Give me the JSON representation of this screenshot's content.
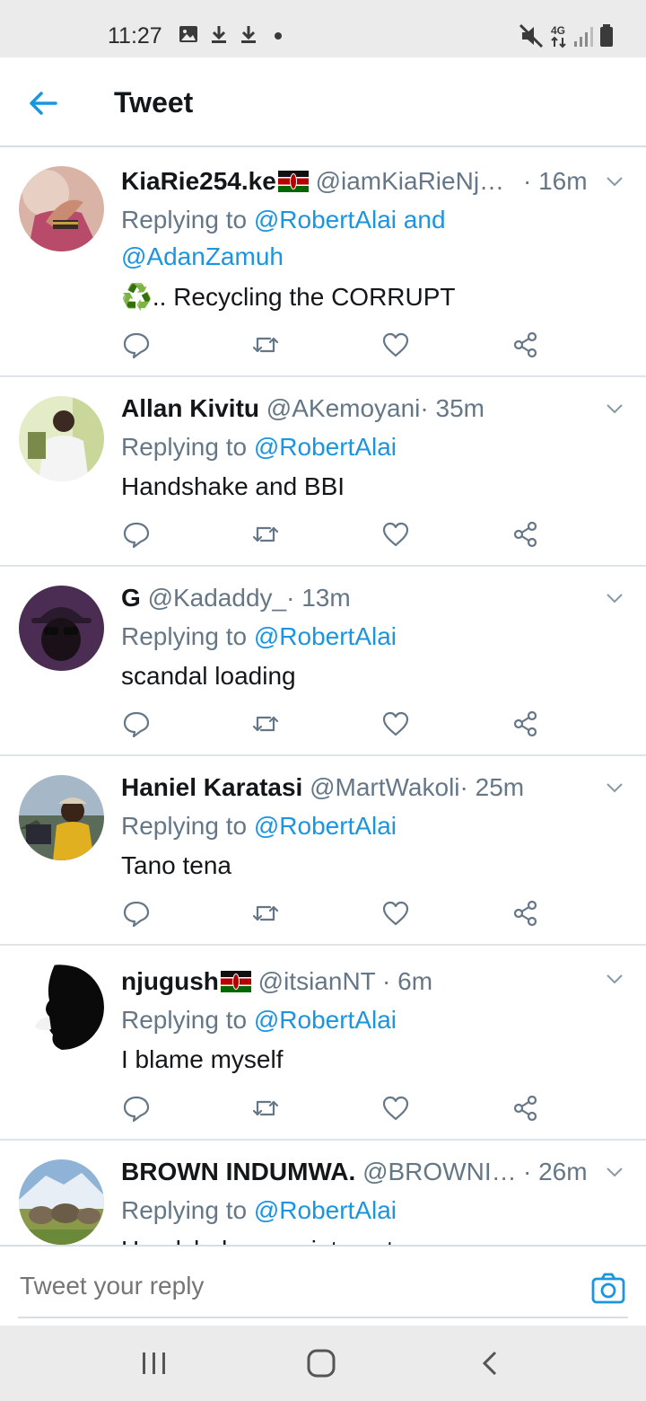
{
  "status_bar": {
    "time": "11:27",
    "left_icons": [
      "image-icon",
      "download-icon",
      "download-icon",
      "dot-icon"
    ],
    "right_icons": [
      "mute-icon",
      "4g-icon",
      "signal-icon",
      "battery-icon"
    ],
    "network_label": "4G"
  },
  "header": {
    "title": "Tweet",
    "back_icon": "arrow-left-icon"
  },
  "colors": {
    "accent": "#1b95e0",
    "text": "#14171a",
    "secondary": "#657786",
    "divider": "#dfe4e8",
    "system_bar": "#ebebeb"
  },
  "tweets": [
    {
      "name": "KiaRie254.ke",
      "has_flag": true,
      "handle": "@iamKiaRieNj…",
      "time": "· 16m",
      "replying_prefix": "Replying to",
      "mentions_line1": "@RobertAlai and",
      "mentions_line2": "@AdanZamuh",
      "text_emoji": "♻️",
      "text": ".. Recycling the CORRUPT"
    },
    {
      "name": "Allan Kivitu",
      "has_flag": false,
      "handle": "@AKemoyani",
      "time": "· 35m",
      "replying_prefix": "Replying to",
      "mentions_line1": "@RobertAlai",
      "text": "Handshake and BBI"
    },
    {
      "name": "G",
      "has_flag": false,
      "handle": "@Kadaddy_",
      "time": "· 13m",
      "replying_prefix": "Replying to",
      "mentions_line1": "@RobertAlai",
      "text": "scandal loading"
    },
    {
      "name": "Haniel Karatasi",
      "has_flag": false,
      "handle": "@MartWakoli",
      "time": "· 25m",
      "replying_prefix": "Replying to",
      "mentions_line1": "@RobertAlai",
      "text": "Tano tena"
    },
    {
      "name": "njugush",
      "has_flag": true,
      "handle": "@itsianNT",
      "time": "· 6m",
      "replying_prefix": "Replying to",
      "mentions_line1": "@RobertAlai",
      "text": "I blame myself"
    },
    {
      "name": "BROWN INDUMWA.",
      "has_flag": false,
      "handle": "@BROWNI…",
      "time": "· 26m",
      "replying_prefix": "Replying to",
      "mentions_line1": "@RobertAlai",
      "text": "Handshake appointment"
    }
  ],
  "action_icons": [
    "reply-icon",
    "retweet-icon",
    "like-icon",
    "share-icon"
  ],
  "reply_bar": {
    "placeholder": "Tweet your reply",
    "camera_icon": "camera-icon"
  },
  "nav_bar": {
    "icons": [
      "recent-apps-icon",
      "home-icon",
      "back-icon"
    ]
  }
}
